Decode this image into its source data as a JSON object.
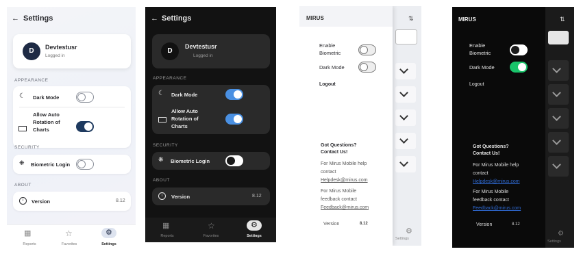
{
  "colors": {
    "light_accent": "#1e3a5f",
    "dark_accent": "#4a90e2",
    "green_toggle": "#19c36a",
    "link_blue": "#2f6bd6"
  },
  "settings": {
    "title": "Settings",
    "user_name": "Devtestusr",
    "user_status": "Logged in",
    "avatar_initial": "D",
    "appearance_header": "APPEARANCE",
    "dark_mode_label": "Dark Mode",
    "allow_rotation_label_1": "Allow Auto",
    "allow_rotation_label_2": "Rotation of",
    "allow_rotation_label_3": "Charts",
    "security_header": "SECURITY",
    "biometric_label": "Biometric Login",
    "about_header": "ABOUT",
    "version_label": "Version",
    "version_value": "8.12"
  },
  "light_state": {
    "dark_mode": false,
    "auto_rotation": true,
    "biometric": false
  },
  "dark_state": {
    "dark_mode": true,
    "auto_rotation": true,
    "biometric": false
  },
  "nav": {
    "reports": "Reports",
    "favorites": "Favorites",
    "settings": "Settings"
  },
  "drawer": {
    "brand": "MIRUS",
    "enable_label_1": "Enable",
    "enable_label_2": "Biometric",
    "dark_mode_label": "Dark Mode",
    "logout": "Logout",
    "questions_1": "Got Questions?",
    "questions_2": "Contact Us!",
    "help_1": "For Mirus Mobile help",
    "help_2": "contact",
    "help_email": "Helpdesk@mirus.com",
    "feedback_1": "For Mirus Mobile",
    "feedback_2": "feedback contact",
    "feedback_email": "Feedback@mirus.com",
    "version_label": "Version",
    "version_value": "8.12",
    "settings_nav": "Settings"
  },
  "drawer_light_state": {
    "biometric": false,
    "dark_mode": false
  },
  "drawer_dark_state": {
    "biometric": false,
    "dark_mode": true
  }
}
